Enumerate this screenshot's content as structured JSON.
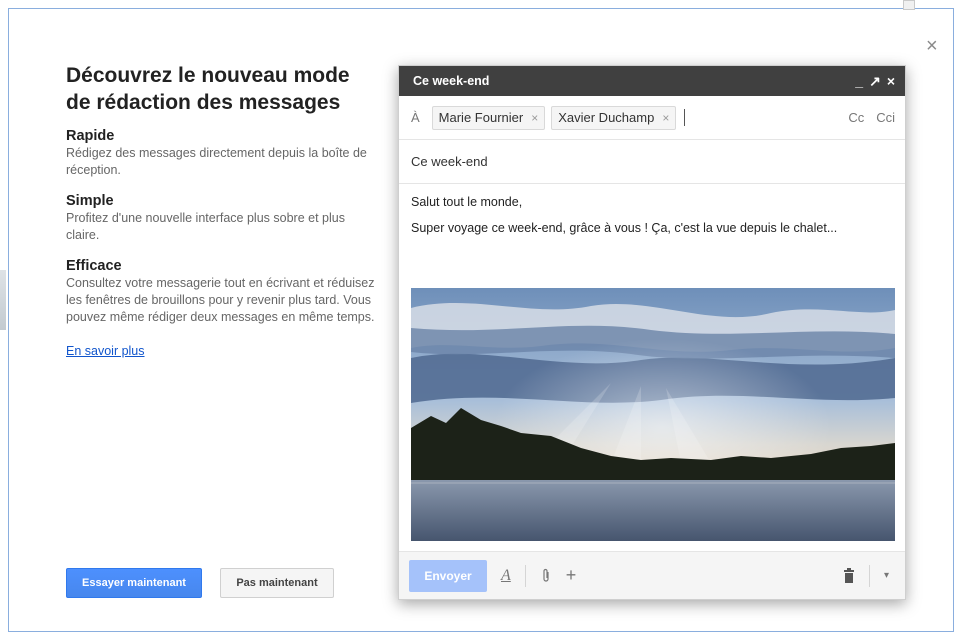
{
  "intro": {
    "headline": "Découvrez le nouveau mode de rédaction des messages",
    "features": [
      {
        "title": "Rapide",
        "text": "Rédigez des messages directement depuis la boîte de réception."
      },
      {
        "title": "Simple",
        "text": "Profitez d'une nouvelle interface plus sobre et plus claire."
      },
      {
        "title": "Efficace",
        "text": "Consultez votre messagerie tout en écrivant et réduisez les fenêtres de brouillons pour y revenir plus tard. Vous pouvez même rédiger deux messages en même temps."
      }
    ],
    "learn_more": "En savoir plus"
  },
  "buttons": {
    "try_now": "Essayer maintenant",
    "not_now": "Pas maintenant"
  },
  "compose": {
    "title": "Ce week-end",
    "to_label": "À",
    "recipients": [
      "Marie Fournier",
      "Xavier Duchamp"
    ],
    "chip_remove": "×",
    "cc": "Cc",
    "bcc": "Cci",
    "subject": "Ce week-end",
    "body_lines": [
      "Salut tout le monde,",
      "Super voyage ce week-end, grâce à vous ! Ça, c'est la vue depuis le chalet..."
    ],
    "send_label": "Envoyer"
  },
  "icons": {
    "close": "close-icon",
    "minimize": "minimize-icon",
    "popout": "popout-icon",
    "compose_close": "close-icon",
    "format": "format-text-icon",
    "attach": "paperclip-icon",
    "more_insert": "plus-icon",
    "trash": "trash-icon",
    "more_options": "chevron-down-icon"
  },
  "colors": {
    "primary_button": "#4d90fe",
    "send_button": "#a5c2fa",
    "compose_header": "#404040",
    "link": "#1155cc"
  }
}
